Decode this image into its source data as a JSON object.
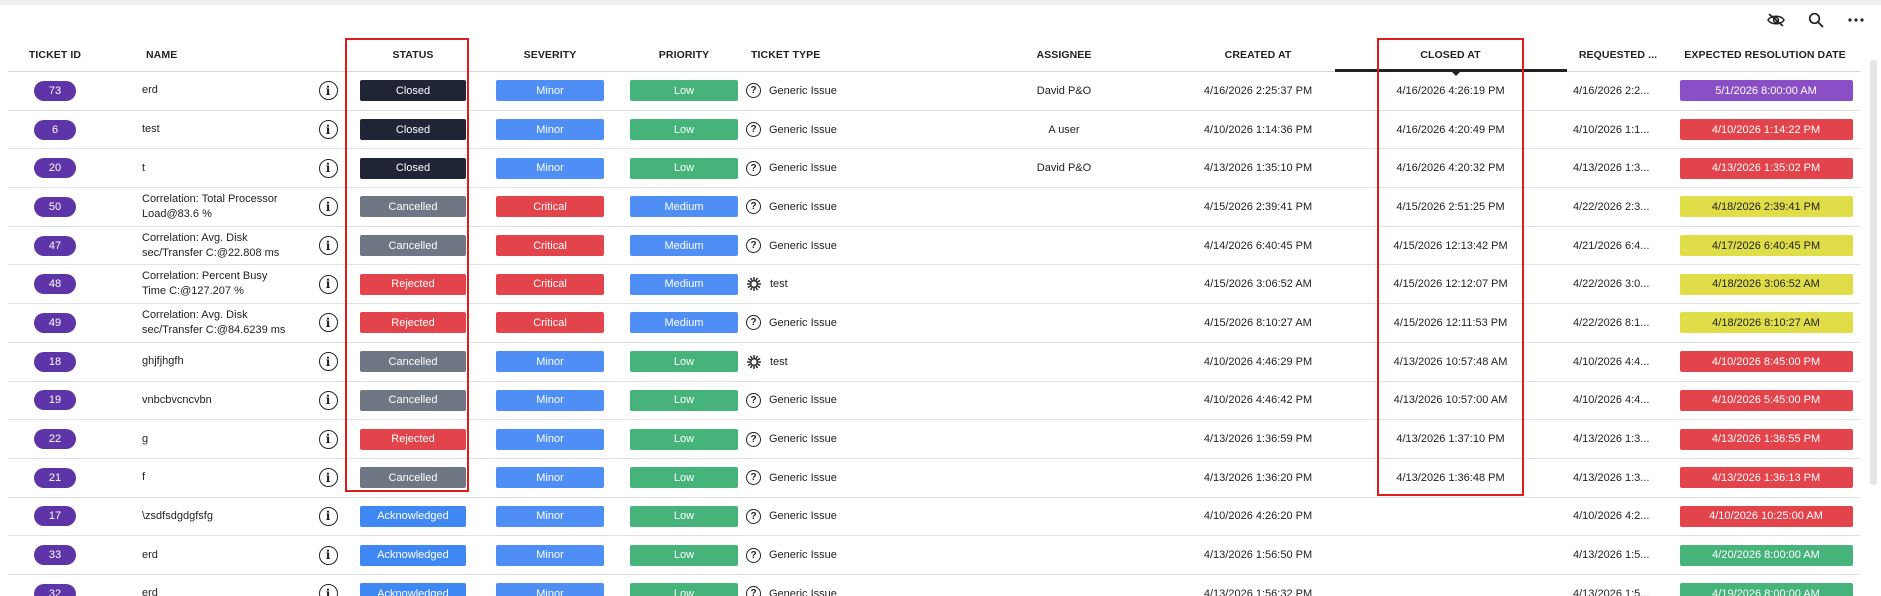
{
  "toolbar": {
    "icons": [
      "hide-columns-icon",
      "search-icon",
      "more-icon"
    ]
  },
  "columns": {
    "ticket_id": "TICKET ID",
    "name": "NAME",
    "status": "STATUS",
    "severity": "SEVERITY",
    "priority": "PRIORITY",
    "ticket_type": "TICKET TYPE",
    "assignee": "ASSIGNEE",
    "created_at": "CREATED AT",
    "closed_at": "CLOSED AT",
    "requested": "REQUESTED ...",
    "expected": "EXPECTED RESOLUTION DATE"
  },
  "colors": {
    "id_pill": "#5e35a8",
    "status": {
      "Closed": "#1f2535",
      "Cancelled": "#707784",
      "Rejected": "#e3434a",
      "Acknowledged": "#3f88f4"
    },
    "severity": {
      "Minor": "#4f8ef4",
      "Critical": "#e3434a"
    },
    "priority": {
      "Low": "#46b47a",
      "Medium": "#4f8ef4"
    },
    "due": {
      "purple": "#8a4fc6",
      "red": "#e3434a",
      "yellow": "#e0de48",
      "green": "#46b47a"
    },
    "highlight": "#e01b1b"
  },
  "rows": [
    {
      "id": "73",
      "name": "erd",
      "status": "Closed",
      "severity": "Minor",
      "priority": "Low",
      "type": "Generic Issue",
      "type_icon": "question-circle-icon",
      "assignee": "David P&O",
      "created": "4/16/2026 2:25:37 PM",
      "closed": "4/16/2026 4:26:19 PM",
      "requested": "4/16/2026 2:2...",
      "expected": "5/1/2026 8:00:00 AM",
      "expected_color": "purple"
    },
    {
      "id": "6",
      "name": "test",
      "status": "Closed",
      "severity": "Minor",
      "priority": "Low",
      "type": "Generic Issue",
      "type_icon": "question-circle-icon",
      "assignee": "A user",
      "created": "4/10/2026 1:14:36 PM",
      "closed": "4/16/2026 4:20:49 PM",
      "requested": "4/10/2026 1:1...",
      "expected": "4/10/2026 1:14:22 PM",
      "expected_color": "red"
    },
    {
      "id": "20",
      "name": "t",
      "status": "Closed",
      "severity": "Minor",
      "priority": "Low",
      "type": "Generic Issue",
      "type_icon": "question-circle-icon",
      "assignee": "David P&O",
      "created": "4/13/2026 1:35:10 PM",
      "closed": "4/16/2026 4:20:32 PM",
      "requested": "4/13/2026 1:3...",
      "expected": "4/13/2026 1:35:02 PM",
      "expected_color": "red"
    },
    {
      "id": "50",
      "name": "Correlation: Total Processor Load@83.6 %",
      "status": "Cancelled",
      "severity": "Critical",
      "priority": "Medium",
      "type": "Generic Issue",
      "type_icon": "question-circle-icon",
      "assignee": "",
      "created": "4/15/2026 2:39:41 PM",
      "closed": "4/15/2026 2:51:25 PM",
      "requested": "4/22/2026 2:3...",
      "expected": "4/18/2026 2:39:41 PM",
      "expected_color": "yellow"
    },
    {
      "id": "47",
      "name": "Correlation: Avg. Disk sec/Transfer C:@22.808 ms",
      "status": "Cancelled",
      "severity": "Critical",
      "priority": "Medium",
      "type": "Generic Issue",
      "type_icon": "question-circle-icon",
      "assignee": "",
      "created": "4/14/2026 6:40:45 PM",
      "closed": "4/15/2026 12:13:42 PM",
      "requested": "4/21/2026 6:4...",
      "expected": "4/17/2026 6:40:45 PM",
      "expected_color": "yellow"
    },
    {
      "id": "48",
      "name": "Correlation: Percent Busy Time C:@127.207 %",
      "status": "Rejected",
      "severity": "Critical",
      "priority": "Medium",
      "type": "test",
      "type_icon": "sun-icon",
      "assignee": "",
      "created": "4/15/2026 3:06:52 AM",
      "closed": "4/15/2026 12:12:07 PM",
      "requested": "4/22/2026 3:0...",
      "expected": "4/18/2026 3:06:52 AM",
      "expected_color": "yellow"
    },
    {
      "id": "49",
      "name": "Correlation: Avg. Disk sec/Transfer C:@84.6239 ms",
      "status": "Rejected",
      "severity": "Critical",
      "priority": "Medium",
      "type": "Generic Issue",
      "type_icon": "question-circle-icon",
      "assignee": "",
      "created": "4/15/2026 8:10:27 AM",
      "closed": "4/15/2026 12:11:53 PM",
      "requested": "4/22/2026 8:1...",
      "expected": "4/18/2026 8:10:27 AM",
      "expected_color": "yellow"
    },
    {
      "id": "18",
      "name": "ghjfjhgfh",
      "status": "Cancelled",
      "severity": "Minor",
      "priority": "Low",
      "type": "test",
      "type_icon": "sun-icon",
      "assignee": "",
      "created": "4/10/2026 4:46:29 PM",
      "closed": "4/13/2026 10:57:48 AM",
      "requested": "4/10/2026 4:4...",
      "expected": "4/10/2026 8:45:00 PM",
      "expected_color": "red"
    },
    {
      "id": "19",
      "name": "vnbcbvcncvbn",
      "status": "Cancelled",
      "severity": "Minor",
      "priority": "Low",
      "type": "Generic Issue",
      "type_icon": "question-circle-icon",
      "assignee": "",
      "created": "4/10/2026 4:46:42 PM",
      "closed": "4/13/2026 10:57:00 AM",
      "requested": "4/10/2026 4:4...",
      "expected": "4/10/2026 5:45:00 PM",
      "expected_color": "red"
    },
    {
      "id": "22",
      "name": "g",
      "status": "Rejected",
      "severity": "Minor",
      "priority": "Low",
      "type": "Generic Issue",
      "type_icon": "question-circle-icon",
      "assignee": "",
      "created": "4/13/2026 1:36:59 PM",
      "closed": "4/13/2026 1:37:10 PM",
      "requested": "4/13/2026 1:3...",
      "expected": "4/13/2026 1:36:55 PM",
      "expected_color": "red"
    },
    {
      "id": "21",
      "name": "f",
      "status": "Cancelled",
      "severity": "Minor",
      "priority": "Low",
      "type": "Generic Issue",
      "type_icon": "question-circle-icon",
      "assignee": "",
      "created": "4/13/2026 1:36:20 PM",
      "closed": "4/13/2026 1:36:48 PM",
      "requested": "4/13/2026 1:3...",
      "expected": "4/13/2026 1:36:13 PM",
      "expected_color": "red"
    },
    {
      "id": "17",
      "name": "\\zsdfsdgdgfsfg",
      "status": "Acknowledged",
      "severity": "Minor",
      "priority": "Low",
      "type": "Generic Issue",
      "type_icon": "question-circle-icon",
      "assignee": "",
      "created": "4/10/2026 4:26:20 PM",
      "closed": "",
      "requested": "4/10/2026 4:2...",
      "expected": "4/10/2026 10:25:00 AM",
      "expected_color": "red"
    },
    {
      "id": "33",
      "name": "erd",
      "status": "Acknowledged",
      "severity": "Minor",
      "priority": "Low",
      "type": "Generic Issue",
      "type_icon": "question-circle-icon",
      "assignee": "",
      "created": "4/13/2026 1:56:50 PM",
      "closed": "",
      "requested": "4/13/2026 1:5...",
      "expected": "4/20/2026 8:00:00 AM",
      "expected_color": "green"
    },
    {
      "id": "32",
      "name": "erd",
      "status": "Acknowledged",
      "severity": "Minor",
      "priority": "Low",
      "type": "Generic Issue",
      "type_icon": "question-circle-icon",
      "assignee": "",
      "created": "4/13/2026 1:56:32 PM",
      "closed": "",
      "requested": "4/13/2026 1:5...",
      "expected": "4/19/2026 8:00:00 AM",
      "expected_color": "green"
    }
  ]
}
